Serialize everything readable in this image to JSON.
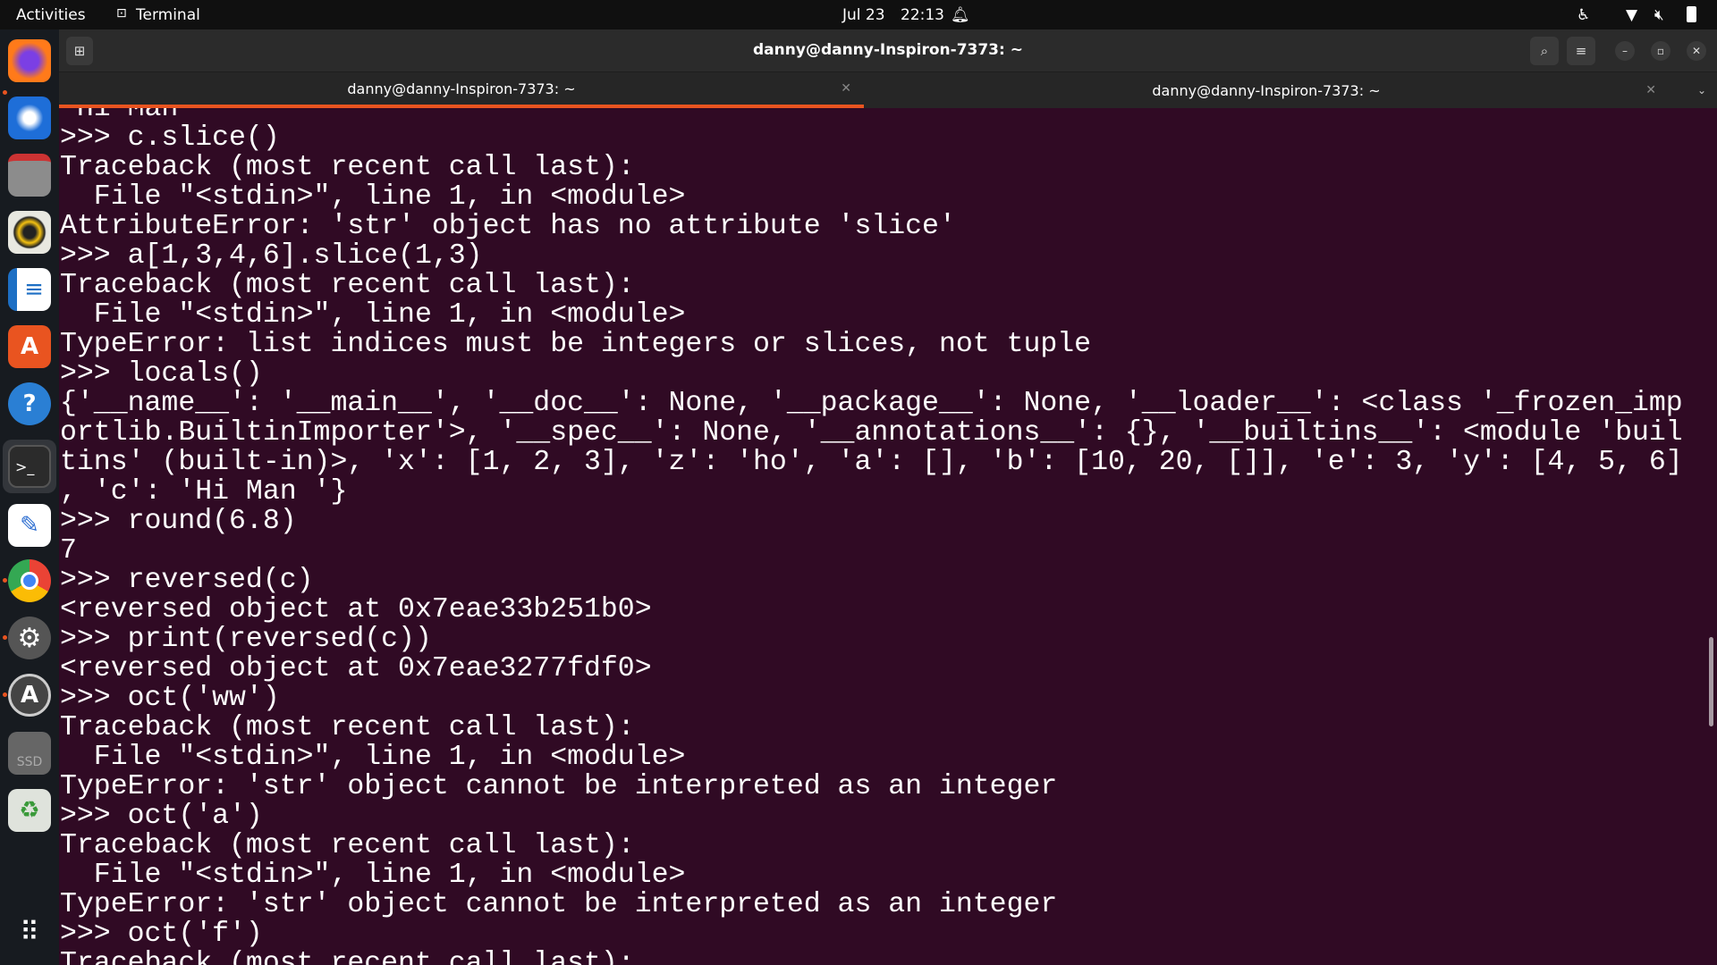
{
  "topbar": {
    "activities": "Activities",
    "app": "Terminal",
    "date": "Jul 23",
    "time": "22:13"
  },
  "window": {
    "title": "danny@danny-Inspiron-7373: ~"
  },
  "tabs": [
    {
      "label": "danny@danny-Inspiron-7373: ~",
      "active": true
    },
    {
      "label": "danny@danny-Inspiron-7373: ~",
      "active": false
    }
  ],
  "accent": "#e95420",
  "dock": [
    "firefox-icon",
    "thunderbird-icon",
    "files-icon",
    "rhythmbox-icon",
    "writer-icon",
    "app-center-icon",
    "help-icon",
    "terminal-icon",
    "text-editor-icon",
    "chrome-icon",
    "settings-icon",
    "software-updater-icon",
    "ssd-drive-icon",
    "trash-icon",
    "app-grid-icon"
  ],
  "ssd_label": "SSD",
  "terminal": {
    "lines": [
      " Hi Man",
      ">>> c.slice()",
      "Traceback (most recent call last):",
      "  File \"<stdin>\", line 1, in <module>",
      "AttributeError: 'str' object has no attribute 'slice'",
      ">>> a[1,3,4,6].slice(1,3)",
      "Traceback (most recent call last):",
      "  File \"<stdin>\", line 1, in <module>",
      "TypeError: list indices must be integers or slices, not tuple",
      ">>> locals()",
      "{'__name__': '__main__', '__doc__': None, '__package__': None, '__loader__': <class '_frozen_imp",
      "ortlib.BuiltinImporter'>, '__spec__': None, '__annotations__': {}, '__builtins__': <module 'buil",
      "tins' (built-in)>, 'x': [1, 2, 3], 'z': 'ho', 'a': [], 'b': [10, 20, []], 'e': 3, 'y': [4, 5, 6]",
      ", 'c': 'Hi Man '}",
      ">>> round(6.8)",
      "7",
      ">>> reversed(c)",
      "<reversed object at 0x7eae33b251b0>",
      ">>> print(reversed(c))",
      "<reversed object at 0x7eae3277fdf0>",
      ">>> oct('ww')",
      "Traceback (most recent call last):",
      "  File \"<stdin>\", line 1, in <module>",
      "TypeError: 'str' object cannot be interpreted as an integer",
      ">>> oct('a')",
      "Traceback (most recent call last):",
      "  File \"<stdin>\", line 1, in <module>",
      "TypeError: 'str' object cannot be interpreted as an integer",
      ">>> oct('f')",
      "Traceback (most recent call last):"
    ]
  }
}
